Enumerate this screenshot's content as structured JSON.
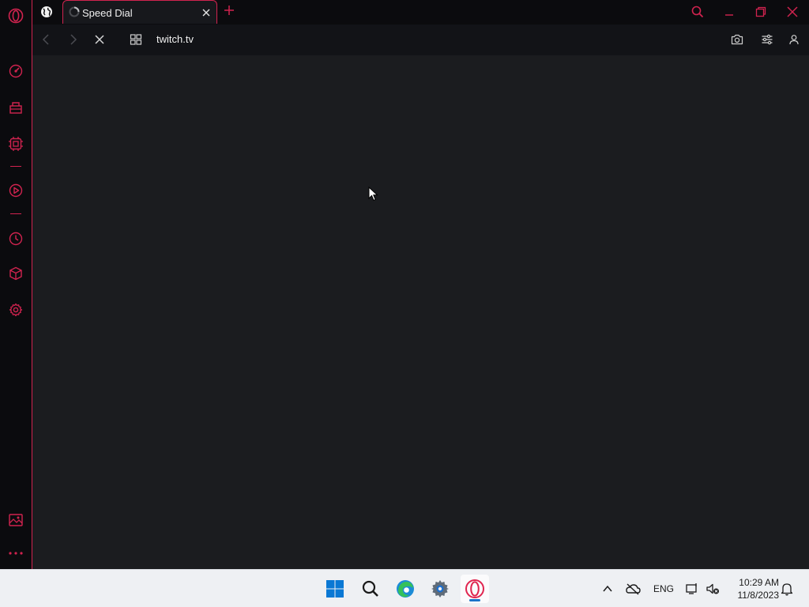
{
  "tab": {
    "title": "Speed Dial"
  },
  "address_bar": {
    "url": "twitch.tv"
  },
  "taskbar": {
    "language": "ENG",
    "time": "10:29 AM",
    "date": "11/8/2023"
  },
  "icons": {
    "sidebar": [
      "opera-logo-icon",
      "speed-dial-icon",
      "shopping-icon",
      "gx-control-icon",
      "player-icon",
      "history-icon",
      "extensions-icon",
      "settings-icon",
      "pinboard-icon",
      "more-icon"
    ],
    "toolbar": [
      "back-icon",
      "forward-icon",
      "stop-loading-icon",
      "tab-grid-icon",
      "camera-icon",
      "easy-setup-icon",
      "profile-icon"
    ]
  },
  "colors": {
    "accent": "#d1234f",
    "page_bg": "#1b1c1f",
    "frame_bg": "#0b0b0e"
  }
}
